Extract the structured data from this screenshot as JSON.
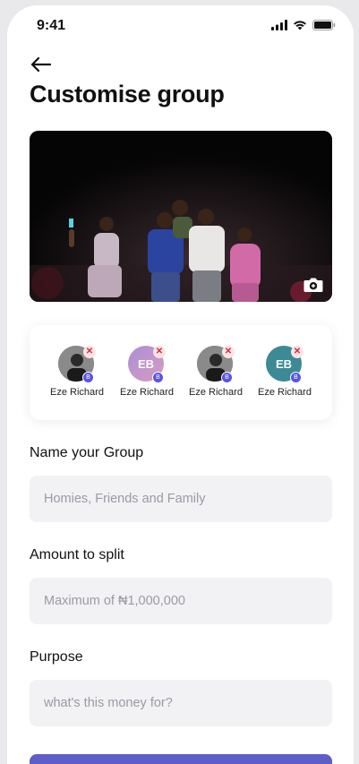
{
  "status_bar": {
    "time": "9:41"
  },
  "header": {
    "title": "Customise group"
  },
  "members": [
    {
      "name": "Eze Richard",
      "avatar_type": "photo",
      "initials": "",
      "avatar_color": "#6a6a6a"
    },
    {
      "name": "Eze Richard",
      "avatar_type": "initials",
      "initials": "EB",
      "avatar_color": "#a98fd6"
    },
    {
      "name": "Eze Richard",
      "avatar_type": "photo",
      "initials": "",
      "avatar_color": "#6a6a6a"
    },
    {
      "name": "Eze Richard",
      "avatar_type": "initials",
      "initials": "EB",
      "avatar_color": "#3b8a96"
    }
  ],
  "form": {
    "group_name": {
      "label": "Name your Group",
      "placeholder": "Homies, Friends and Family"
    },
    "amount": {
      "label": "Amount to split",
      "placeholder": "Maximum of ₦1,000,000"
    },
    "purpose": {
      "label": "Purpose",
      "placeholder": "what's this money for?"
    }
  },
  "colors": {
    "accent": "#5e5ec9",
    "remove": "#d42a3c",
    "field_bg": "#f2f2f5"
  },
  "icons": [
    "back-arrow-icon",
    "camera-icon",
    "signal-icon",
    "wifi-icon",
    "battery-icon",
    "remove-icon",
    "badge-icon"
  ]
}
